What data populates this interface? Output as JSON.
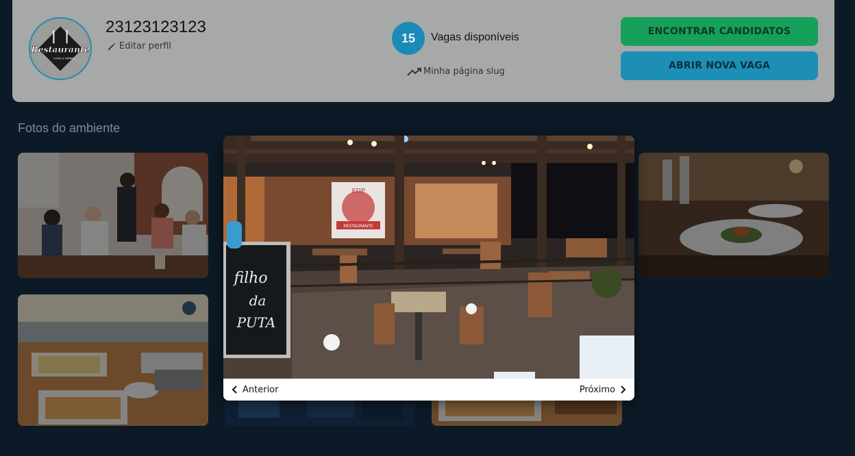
{
  "header": {
    "company_name": "23123123123",
    "edit_profile_label": "Editar perfil",
    "vagas_count": "15",
    "vagas_label": "Vagas disponíveis",
    "slug_label": "Minha página slug",
    "find_candidates_label": "ENCONTRAR CANDIDATOS",
    "open_job_label": "ABRIR NOVA VAGA",
    "logo_text": "Restaurante",
    "logo_subtext": "FOOD & DRINKS"
  },
  "gallery": {
    "title": "Fotos do ambiente",
    "prev_label": "Anterior",
    "next_label": "Próximo",
    "sign_text": "Filho da PUTA",
    "banner_text": "FDP RESTAURANTE"
  },
  "colors": {
    "background": "#0b1a26",
    "header_card": "#a7a8a8",
    "find_button": "#17a05a",
    "open_button": "#1d8fb7",
    "count_badge": "#1b8ab8"
  },
  "icons": [
    "pencil-icon",
    "trending-up-icon",
    "chevron-left-icon",
    "chevron-right-icon"
  ]
}
